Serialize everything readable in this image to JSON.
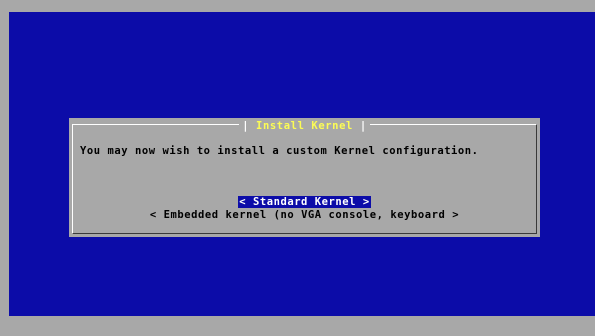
{
  "dialog": {
    "title": "Install Kernel",
    "message": "You may now wish to install a custom Kernel configuration.",
    "options": [
      {
        "label": "< Standard Kernel >",
        "selected": true
      },
      {
        "label": "< Embedded kernel (no VGA console, keyboard >",
        "selected": false
      }
    ]
  },
  "colors": {
    "background": "#0c0ca8",
    "dialog": "#a8a8a8",
    "title": "#fcfc54",
    "highlight": "#0c0ca8"
  }
}
